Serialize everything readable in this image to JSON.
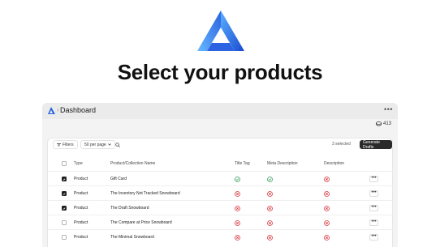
{
  "hero": {
    "headline": "Select your products"
  },
  "app": {
    "breadcrumb_separator": "›",
    "title": "Dashboard",
    "more_menu": "•••",
    "credits": "413"
  },
  "toolbar": {
    "filters_label": "Filters",
    "per_page_label": "50 per page",
    "selected_count": "3 selected",
    "generate_label": "Generate Drafts"
  },
  "table": {
    "headers": {
      "type": "Type",
      "name": "Product/Collection Name",
      "title_tag": "Title Tag",
      "meta": "Meta Description",
      "description": "Description"
    },
    "rows": [
      {
        "type": "Product",
        "name": "Gift Card",
        "checked": true,
        "title_tag": "ok",
        "meta": "ok",
        "description": "error"
      },
      {
        "type": "Product",
        "name": "The Inventory Not Tracked Snowboard",
        "checked": true,
        "title_tag": "error",
        "meta": "error",
        "description": "error"
      },
      {
        "type": "Product",
        "name": "The Draft Snowboard",
        "checked": true,
        "title_tag": "error",
        "meta": "error",
        "description": "error"
      },
      {
        "type": "Product",
        "name": "The Compare at Price Snowboard",
        "checked": false,
        "title_tag": "error",
        "meta": "error",
        "description": "error"
      },
      {
        "type": "Product",
        "name": "The Minimal Snowboard",
        "checked": false,
        "title_tag": "error",
        "meta": "error",
        "description": "error"
      }
    ],
    "row_action": "•••"
  },
  "colors": {
    "ok": "#2e9e5a",
    "error": "#d9363e",
    "brand_light": "#4da3ff",
    "brand_dark": "#1f4fd6"
  }
}
